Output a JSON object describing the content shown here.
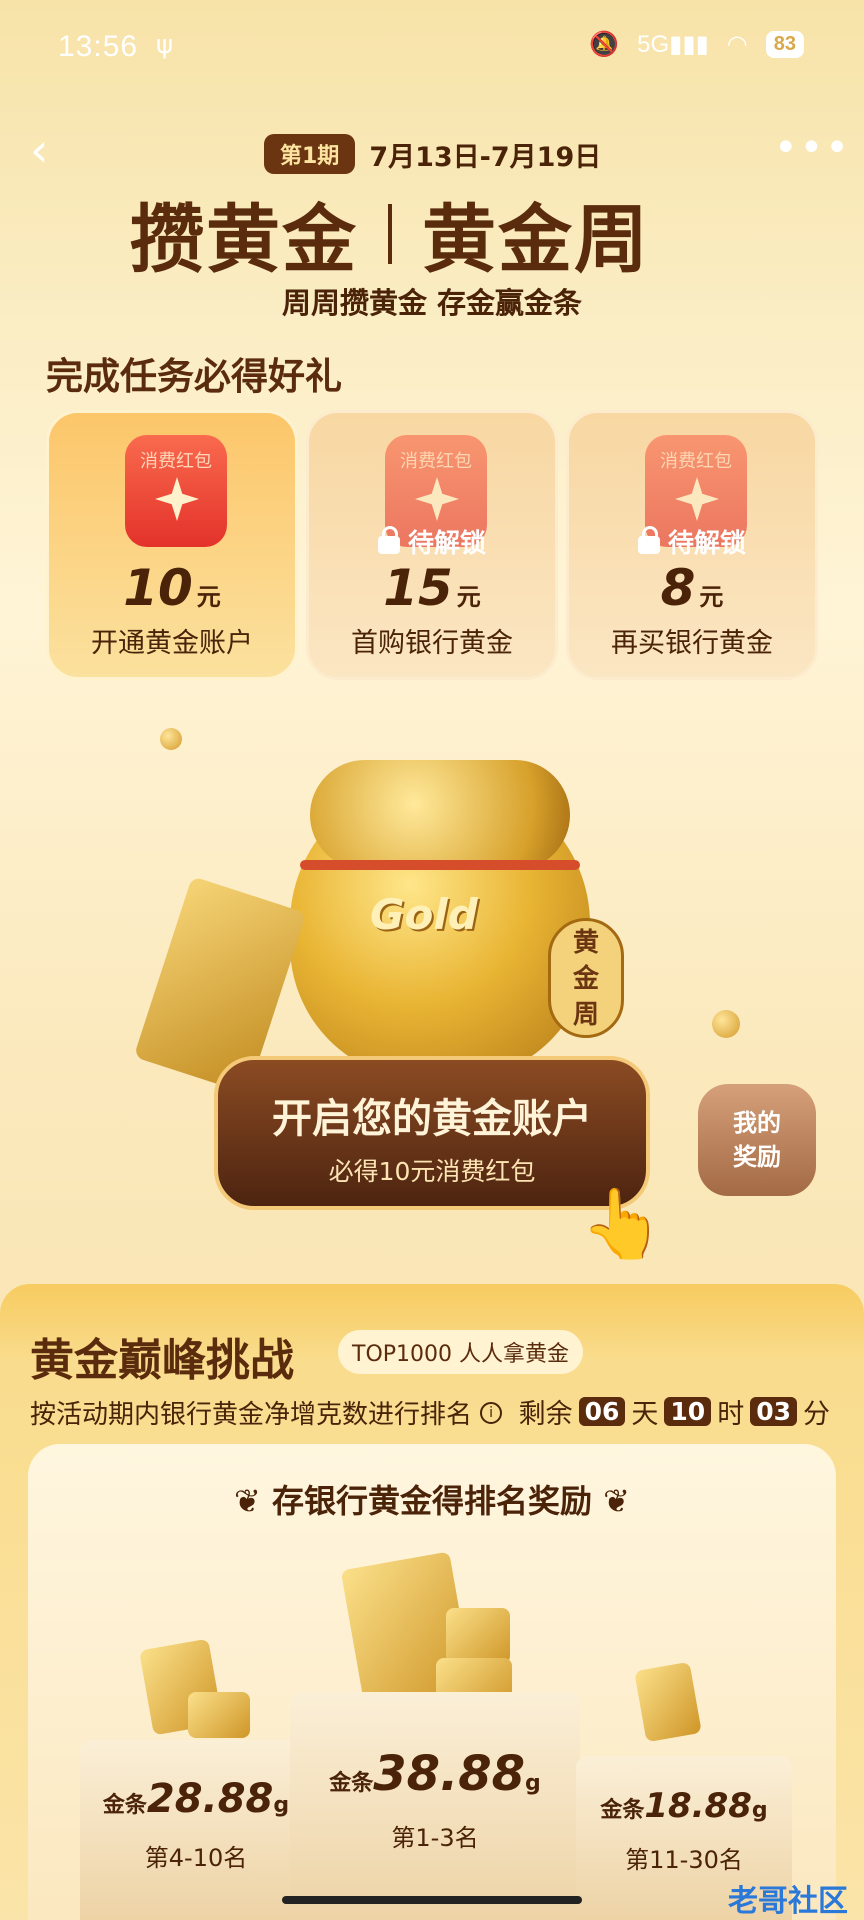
{
  "status_bar": {
    "time": "13:56",
    "network": "5G",
    "battery": "83"
  },
  "header": {
    "period_badge": "第1期",
    "period_dates": "7月13日-7月19日",
    "title_left": "攒黄金",
    "title_right": "黄金周",
    "subtitle": "周周攒黄金 存金赢金条"
  },
  "tasks": {
    "heading": "完成任务必得好礼",
    "envelope_label": "消费红包",
    "lock_text": "待解锁",
    "unit": "元",
    "items": [
      {
        "amount": "10",
        "label": "开通黄金账户",
        "locked": false
      },
      {
        "amount": "15",
        "label": "首购银行黄金",
        "locked": true
      },
      {
        "amount": "8",
        "label": "再买银行黄金",
        "locked": true
      }
    ]
  },
  "hero": {
    "bag_text": "Gold",
    "seal_text": "黄金周"
  },
  "cta": {
    "title": "开启您的黄金账户",
    "subtitle": "必得10元消费红包"
  },
  "my_reward": {
    "line1": "我的",
    "line2": "奖励"
  },
  "challenge": {
    "title": "黄金巅峰挑战",
    "badge": "TOP1000 人人拿黄金",
    "desc": "按活动期内银行黄金净增克数进行排名",
    "countdown": {
      "prefix": "剩余",
      "days": "06",
      "days_unit": "天",
      "hours": "10",
      "hours_unit": "时",
      "minutes": "03",
      "minutes_unit": "分"
    },
    "rank_title": "存银行黄金得排名奖励",
    "prizes": [
      {
        "prefix": "金条",
        "amount": "28.88",
        "unit": "g",
        "rank": "第4-10名"
      },
      {
        "prefix": "金条",
        "amount": "38.88",
        "unit": "g",
        "rank": "第1-3名"
      },
      {
        "prefix": "金条",
        "amount": "18.88",
        "unit": "g",
        "rank": "第11-30名"
      }
    ]
  },
  "watermark": "老哥社区",
  "colors": {
    "brown": "#5a2b0c",
    "gold": "#f7cb60",
    "red": "#e3322a"
  }
}
